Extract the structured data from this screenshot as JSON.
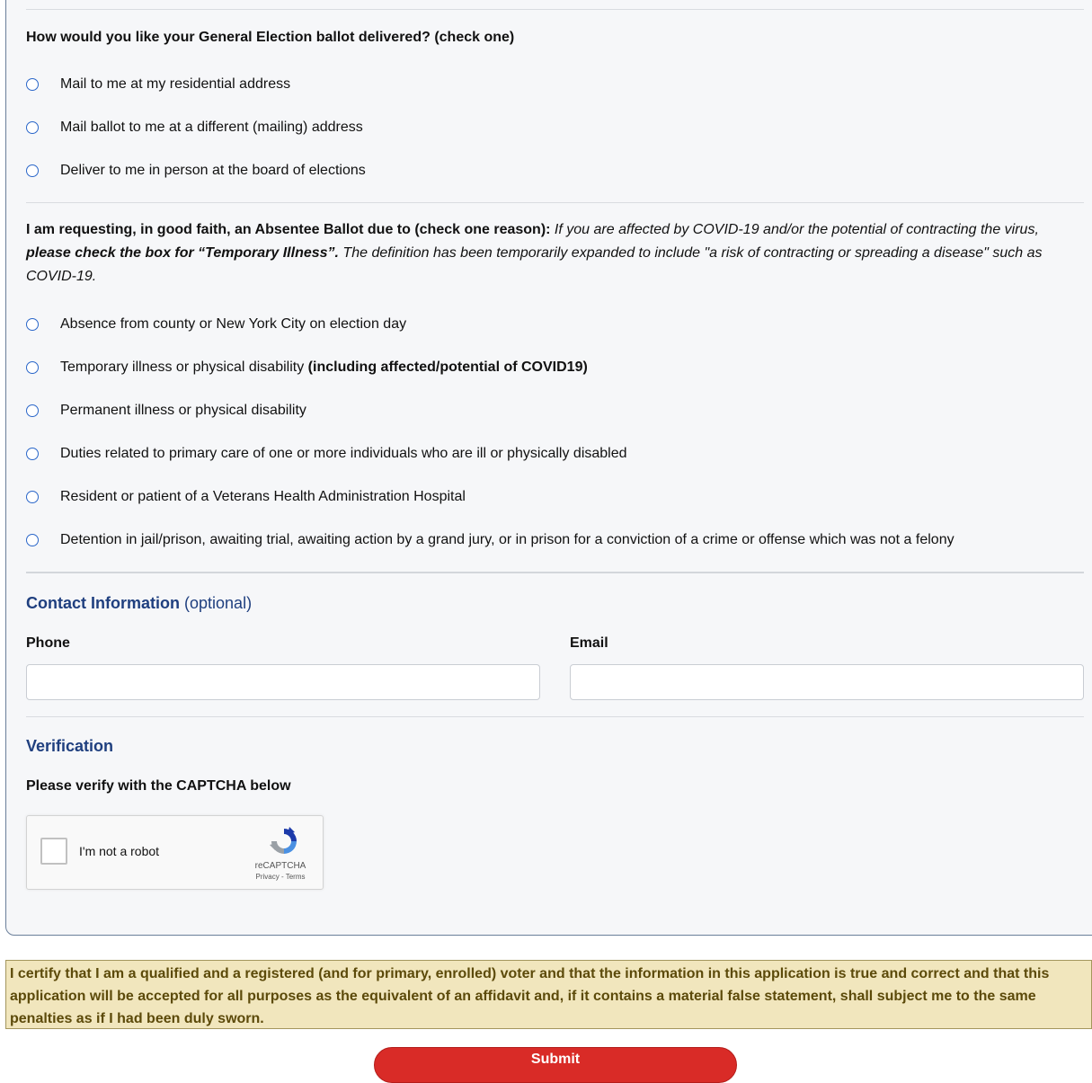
{
  "delivery": {
    "question": "How would you like your General Election ballot delivered? (check one)",
    "options": [
      "Mail to me at my residential address",
      "Mail ballot to me at a different (mailing) address",
      "Deliver to me in person at the board of elections"
    ]
  },
  "reason": {
    "lead": "I am requesting, in good faith, an Absentee Ballot due to (check one reason):",
    "note_part1": " If you are affected by COVID-19 and/or the potential of contracting the virus, ",
    "note_bold": "please check the box for “Temporary Illness”.",
    "note_part2": " The definition has been temporarily expanded to include \"a risk of contracting or spreading a disease\" such as COVID-19.",
    "options": [
      "Absence from county or New York City on election day",
      "Temporary illness or physical disability",
      "Permanent illness or physical disability",
      "Duties related to primary care of one or more individuals who are ill or physically disabled",
      "Resident or patient of a Veterans Health Administration Hospital",
      "Detention in jail/prison, awaiting trial, awaiting action by a grand jury, or in prison for a conviction of a crime or offense which was not a felony"
    ],
    "option2_bold": "(including affected/potential of COVID19)"
  },
  "contact": {
    "title": "Contact Information",
    "optional": "(optional)",
    "phone_label": "Phone",
    "phone_value": "",
    "email_label": "Email",
    "email_value": ""
  },
  "verification": {
    "title": "Verification",
    "prompt": "Please verify with the CAPTCHA below",
    "captcha_label": "I'm not a robot",
    "captcha_brand": "reCAPTCHA",
    "captcha_links": "Privacy - Terms"
  },
  "certify": "I certify that I am a qualified and a registered (and for primary, enrolled) voter and that the information in this application is true and correct and that this application will be accepted for all purposes as the equivalent of an affidavit and, if it contains a material false statement, shall subject me to the same penalties as if I had been duly sworn.",
  "submit_label": "Submit",
  "colors": {
    "radio": "#2a66c9",
    "section_title": "#1f3f7f",
    "submit": "#d92b27",
    "certify_bg": "#f1e6bd"
  }
}
